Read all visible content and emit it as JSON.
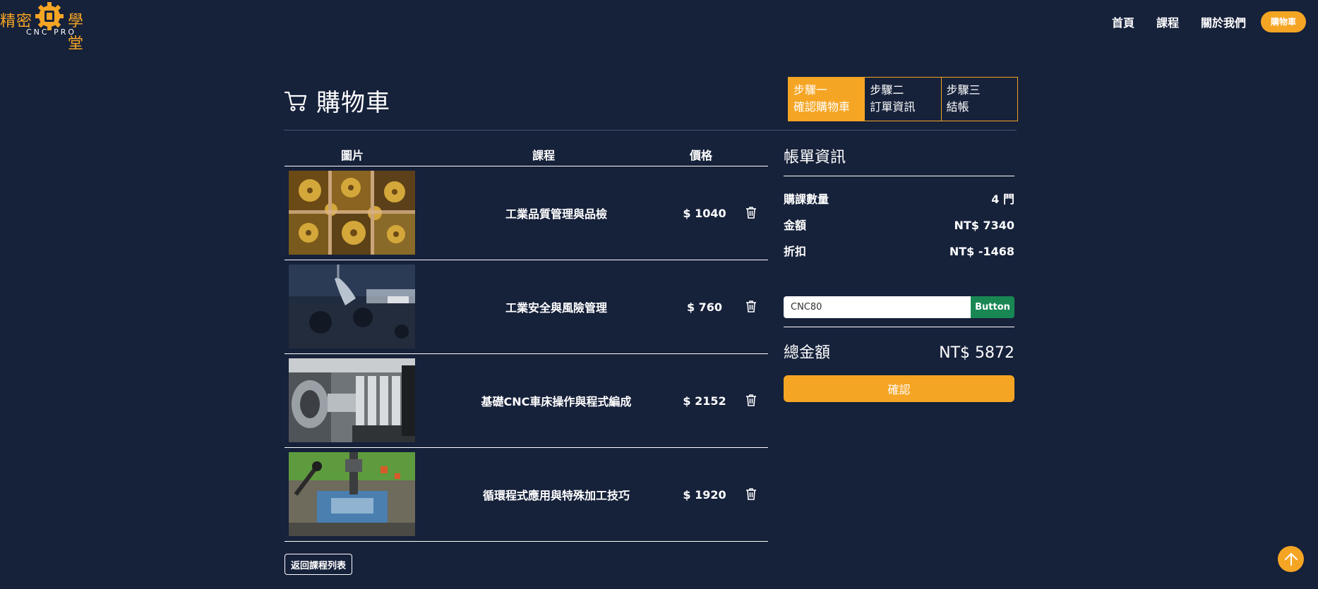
{
  "brand": {
    "left": "精密",
    "right": "學堂",
    "sub": "CNC PRO"
  },
  "nav": {
    "home": "首頁",
    "courses": "課程",
    "about": "關於我們",
    "cart": "購物車"
  },
  "page": {
    "title": "購物車"
  },
  "steps": [
    {
      "label": "步驟一",
      "desc": "確認購物車"
    },
    {
      "label": "步驟二",
      "desc": "訂單資訊"
    },
    {
      "label": "步驟三",
      "desc": "結帳"
    }
  ],
  "table": {
    "headers": {
      "image": "圖片",
      "course": "課程",
      "price": "價格"
    },
    "rows": [
      {
        "course": "工業品質管理與品檢",
        "price": "$ 1040"
      },
      {
        "course": "工業安全與風險管理",
        "price": "$ 760"
      },
      {
        "course": "基礎CNC車床操作與程式編成",
        "price": "$ 2152"
      },
      {
        "course": "循環程式應用與特殊加工技巧",
        "price": "$ 1920"
      }
    ]
  },
  "back_label": "返回課程列表",
  "bill": {
    "title": "帳單資訊",
    "count_label": "購課數量",
    "count_value": "4 門",
    "amount_label": "金額",
    "amount_value": "NT$ 7340",
    "discount_label": "折扣",
    "discount_value": "NT$ -1468",
    "coupon_value": "CNC80",
    "coupon_button": "Button",
    "total_label": "總金額",
    "total_value": "NT$ 5872",
    "confirm_label": "確認"
  },
  "colors": {
    "background": "#16213a",
    "accent": "#f5a524",
    "success": "#198754"
  }
}
